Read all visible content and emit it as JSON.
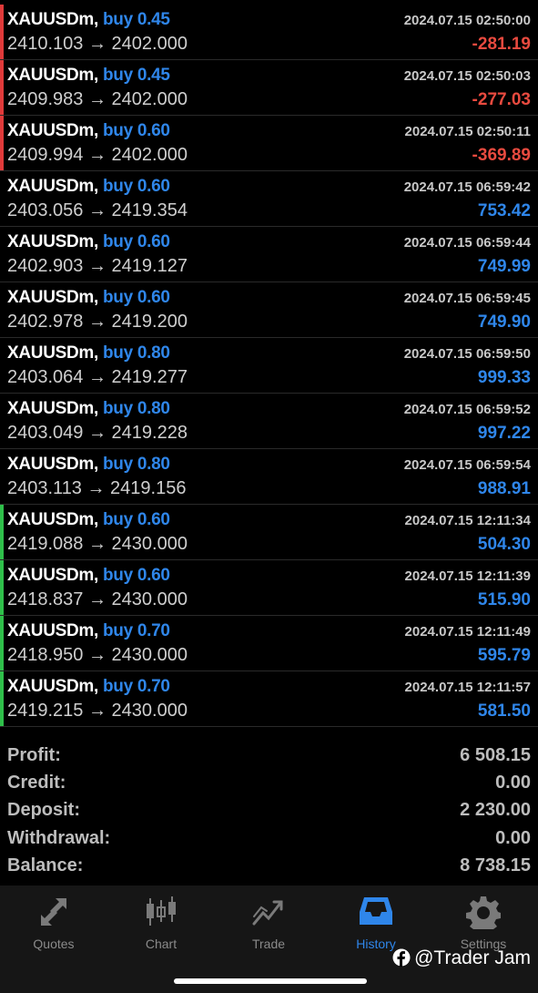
{
  "colors": {
    "accent": "#2f86ea",
    "loss": "#e84a3f",
    "profit": "#2f86ea",
    "red_marker": "#e03a3a",
    "green_marker": "#2fbf4a"
  },
  "trades": [
    {
      "symbol": "XAUUSDm,",
      "type": "buy 0.45",
      "time": "2024.07.15 02:50:00",
      "prices": "2410.103 → 2402.000",
      "profit": "-281.19",
      "marker": "red"
    },
    {
      "symbol": "XAUUSDm,",
      "type": "buy 0.45",
      "time": "2024.07.15 02:50:03",
      "prices": "2409.983 → 2402.000",
      "profit": "-277.03",
      "marker": "red"
    },
    {
      "symbol": "XAUUSDm,",
      "type": "buy 0.60",
      "time": "2024.07.15 02:50:11",
      "prices": "2409.994 → 2402.000",
      "profit": "-369.89",
      "marker": "red"
    },
    {
      "symbol": "XAUUSDm,",
      "type": "buy 0.60",
      "time": "2024.07.15 06:59:42",
      "prices": "2403.056 → 2419.354",
      "profit": "753.42",
      "marker": "none"
    },
    {
      "symbol": "XAUUSDm,",
      "type": "buy 0.60",
      "time": "2024.07.15 06:59:44",
      "prices": "2402.903 → 2419.127",
      "profit": "749.99",
      "marker": "none"
    },
    {
      "symbol": "XAUUSDm,",
      "type": "buy 0.60",
      "time": "2024.07.15 06:59:45",
      "prices": "2402.978 → 2419.200",
      "profit": "749.90",
      "marker": "none"
    },
    {
      "symbol": "XAUUSDm,",
      "type": "buy 0.80",
      "time": "2024.07.15 06:59:50",
      "prices": "2403.064 → 2419.277",
      "profit": "999.33",
      "marker": "none"
    },
    {
      "symbol": "XAUUSDm,",
      "type": "buy 0.80",
      "time": "2024.07.15 06:59:52",
      "prices": "2403.049 → 2419.228",
      "profit": "997.22",
      "marker": "none"
    },
    {
      "symbol": "XAUUSDm,",
      "type": "buy 0.80",
      "time": "2024.07.15 06:59:54",
      "prices": "2403.113 → 2419.156",
      "profit": "988.91",
      "marker": "none"
    },
    {
      "symbol": "XAUUSDm,",
      "type": "buy 0.60",
      "time": "2024.07.15 12:11:34",
      "prices": "2419.088 → 2430.000",
      "profit": "504.30",
      "marker": "green"
    },
    {
      "symbol": "XAUUSDm,",
      "type": "buy 0.60",
      "time": "2024.07.15 12:11:39",
      "prices": "2418.837 → 2430.000",
      "profit": "515.90",
      "marker": "green"
    },
    {
      "symbol": "XAUUSDm,",
      "type": "buy 0.70",
      "time": "2024.07.15 12:11:49",
      "prices": "2418.950 → 2430.000",
      "profit": "595.79",
      "marker": "green"
    },
    {
      "symbol": "XAUUSDm,",
      "type": "buy 0.70",
      "time": "2024.07.15 12:11:57",
      "prices": "2419.215 → 2430.000",
      "profit": "581.50",
      "marker": "green"
    }
  ],
  "summary": [
    {
      "label": "Profit:",
      "value": "6 508.15"
    },
    {
      "label": "Credit:",
      "value": "0.00"
    },
    {
      "label": "Deposit:",
      "value": "2 230.00"
    },
    {
      "label": "Withdrawal:",
      "value": "0.00"
    },
    {
      "label": "Balance:",
      "value": "8 738.15"
    }
  ],
  "tabs": [
    {
      "label": "Quotes",
      "icon": "quotes-arrows-icon",
      "active": false
    },
    {
      "label": "Chart",
      "icon": "candlestick-chart-icon",
      "active": false
    },
    {
      "label": "Trade",
      "icon": "trade-trend-icon",
      "active": false
    },
    {
      "label": "History",
      "icon": "history-inbox-icon",
      "active": true
    },
    {
      "label": "Settings",
      "icon": "settings-gear-icon",
      "active": false
    }
  ],
  "watermark": {
    "text": "@Trader Jam",
    "icon": "facebook-icon"
  }
}
